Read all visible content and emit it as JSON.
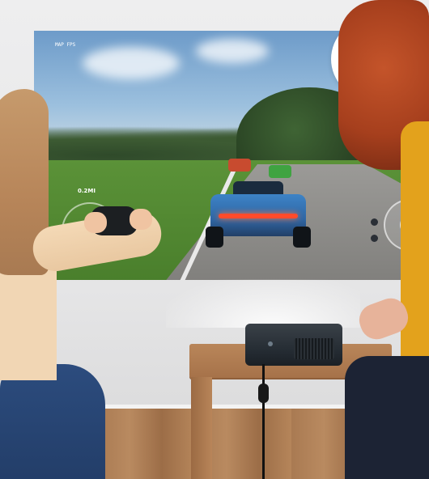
{
  "hud": {
    "top_left_text": "MAP FPS",
    "distance_text": "0.2MI"
  },
  "icons": {
    "badge": "gamepad-icon"
  }
}
